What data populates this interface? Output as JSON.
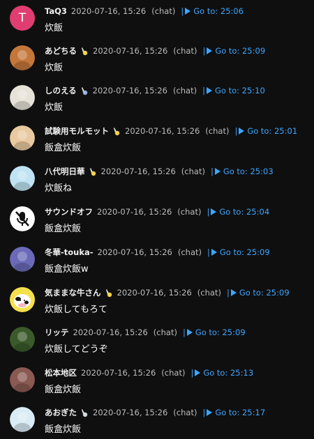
{
  "chat": {
    "messages": [
      {
        "author": "TaQ3",
        "badge": false,
        "timestamp": "2020-07-16, 15:26",
        "source": "(chat)",
        "goto_label": "Go to: 25:06",
        "text": "炊飯",
        "avatar_kind": "letter",
        "avatar_letter": "T",
        "avatar_color": "#e03e70"
      },
      {
        "author": "あどちる",
        "badge": true,
        "badge_color": "#f2d24c",
        "timestamp": "2020-07-16, 15:26",
        "source": "(chat)",
        "goto_label": "Go to: 25:09",
        "text": "炊飯",
        "avatar_kind": "image",
        "avatar_color": "#c4773a"
      },
      {
        "author": "しのえる",
        "badge": true,
        "badge_color": "#9eb3e8",
        "timestamp": "2020-07-16, 15:26",
        "source": "(chat)",
        "goto_label": "Go to: 25:10",
        "text": "炊飯",
        "avatar_kind": "image",
        "avatar_color": "#e6e2d8"
      },
      {
        "author": "試験用モルモット",
        "badge": true,
        "badge_color": "#f2d24c",
        "timestamp": "2020-07-16, 15:26",
        "source": "(chat)",
        "goto_label": "Go to: 25:01",
        "text": "飯盒炊飯",
        "avatar_kind": "image",
        "avatar_color": "#e8c9a0"
      },
      {
        "author": "八代明日華",
        "badge": true,
        "badge_color": "#f2d24c",
        "timestamp": "2020-07-16, 15:26",
        "source": "(chat)",
        "goto_label": "Go to: 25:03",
        "text": "炊飯ね",
        "avatar_kind": "image",
        "avatar_color": "#bfe3f2"
      },
      {
        "author": "サウンドオフ",
        "badge": false,
        "timestamp": "2020-07-16, 15:26",
        "source": "(chat)",
        "goto_label": "Go to: 25:04",
        "text": "飯盒炊飯",
        "avatar_kind": "muted-mic",
        "avatar_color": "#ffffff"
      },
      {
        "author": "冬華-touka-",
        "badge": false,
        "timestamp": "2020-07-16, 15:26",
        "source": "(chat)",
        "goto_label": "Go to: 25:09",
        "text": "飯盒炊飯w",
        "avatar_kind": "image",
        "avatar_color": "#6a6ab8"
      },
      {
        "author": "気ままな牛さん",
        "badge": true,
        "badge_color": "#f2d24c",
        "timestamp": "2020-07-16, 15:26",
        "source": "(chat)",
        "goto_label": "Go to: 25:09",
        "text": "炊飯してもろて",
        "avatar_kind": "cow",
        "avatar_color": "#f4e04d"
      },
      {
        "author": "リッテ",
        "badge": false,
        "timestamp": "2020-07-16, 15:26",
        "source": "(chat)",
        "goto_label": "Go to: 25:09",
        "text": "炊飯してどうぞ",
        "avatar_kind": "image",
        "avatar_color": "#3a5a2a"
      },
      {
        "author": "松本地区",
        "badge": false,
        "timestamp": "2020-07-16, 15:26",
        "source": "(chat)",
        "goto_label": "Go to: 25:13",
        "text": "飯盒炊飯",
        "avatar_kind": "image",
        "avatar_color": "#8a5a52"
      },
      {
        "author": "あおぎた",
        "badge": true,
        "badge_color": "#cfd8dc",
        "timestamp": "2020-07-16, 15:26",
        "source": "(chat)",
        "goto_label": "Go to: 25:17",
        "text": "飯盒炊飯",
        "avatar_kind": "image",
        "avatar_color": "#d9ecf5"
      }
    ]
  },
  "colors": {
    "background": "#0f0f0f",
    "link": "#3ea6ff",
    "meta_text": "#bdbdbd",
    "author_text": "#f1f1f1"
  }
}
